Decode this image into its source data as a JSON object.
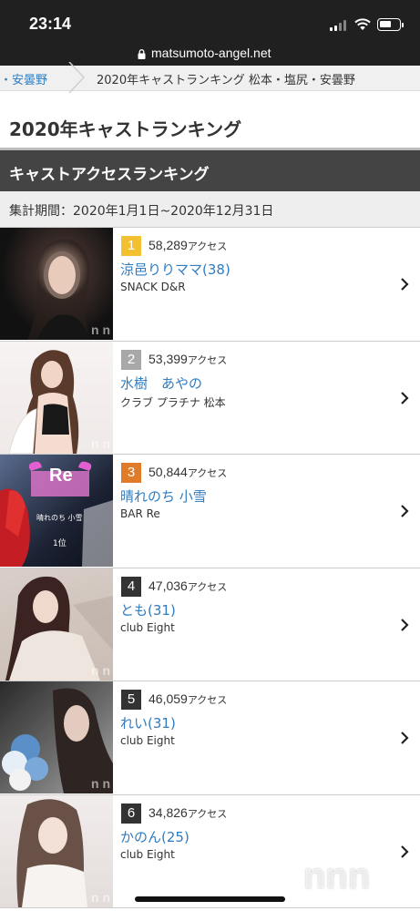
{
  "status_bar": {
    "time": "23:14"
  },
  "browser": {
    "url": "matsumoto-angel.net"
  },
  "breadcrumb": {
    "first": "・安曇野",
    "current": "2020年キャストランキング 松本・塩尻・安曇野"
  },
  "page": {
    "title": "2020年キャストランキング",
    "section_title": "キャストアクセスランキング",
    "period": "集計期間：2020年1月1日~2020年12月31日"
  },
  "rank_colors": {
    "gold": "#f3c02f",
    "silver": "#a8a8a8",
    "bronze": "#e07b2a",
    "default": "#333333"
  },
  "rankings": [
    {
      "rank": "1",
      "access": "58,289",
      "unit": "アクセス",
      "name": "涼邑りりママ(38)",
      "shop": "SNACK D&R"
    },
    {
      "rank": "2",
      "access": "53,399",
      "unit": "アクセス",
      "name": "水樹　あやの",
      "shop": "クラブ プラチナ 松本"
    },
    {
      "rank": "3",
      "access": "50,844",
      "unit": "アクセス",
      "name": "晴れのち 小雪",
      "shop": "BAR Re"
    },
    {
      "rank": "4",
      "access": "47,036",
      "unit": "アクセス",
      "name": "とも(31)",
      "shop": "club Eight"
    },
    {
      "rank": "5",
      "access": "46,059",
      "unit": "アクセス",
      "name": "れい(31)",
      "shop": "club Eight"
    },
    {
      "rank": "6",
      "access": "34,826",
      "unit": "アクセス",
      "name": "かのん(25)",
      "shop": "club Eight"
    }
  ],
  "photo_text": {
    "watermark": "n n",
    "re_logo": "Re",
    "re_caption": "晴れのち 小雪",
    "re_award": "1位"
  },
  "corner_logo": "nnn"
}
